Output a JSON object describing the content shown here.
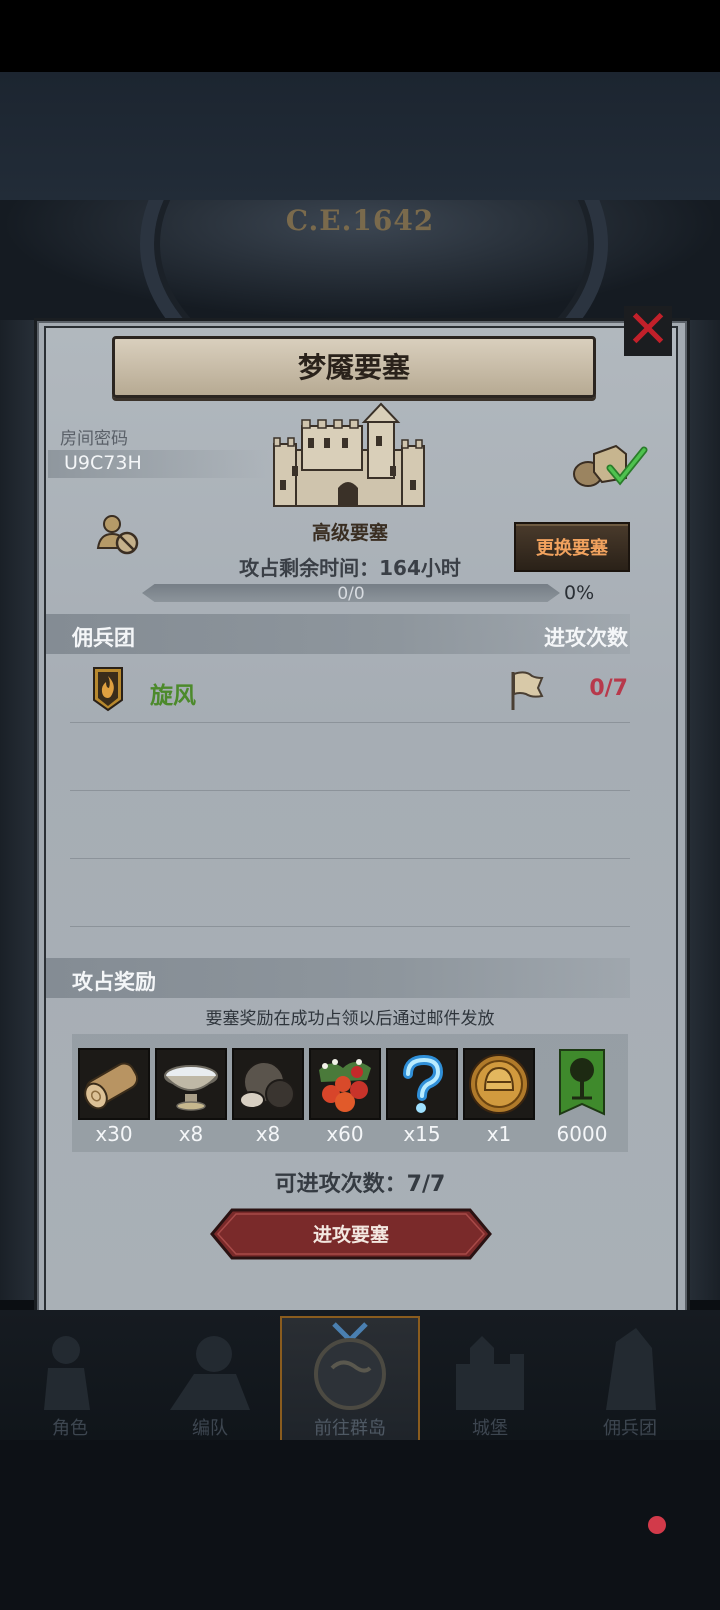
{
  "hud": {
    "year": "C.E.1642"
  },
  "dialog": {
    "title": "梦魇要塞",
    "room_label": "房间密码",
    "room_code": "U9C73H",
    "fortress_level": "高级要塞",
    "change_button": "更换要塞",
    "occupy_time": "攻占剩余时间：164小时",
    "progress": {
      "text": "0/0",
      "percent_label": "0%",
      "fraction": 0
    }
  },
  "mercenary": {
    "header": "佣兵团",
    "attacks_header": "进攻次数",
    "rows": [
      {
        "name": "旋风",
        "attacks": "0/7"
      }
    ]
  },
  "rewards": {
    "header": "攻占奖励",
    "note": "要塞奖励在成功占领以后通过邮件发放",
    "items": [
      {
        "icon": "wood-log-icon",
        "qty": "x30"
      },
      {
        "icon": "stone-bowl-icon",
        "qty": "x8"
      },
      {
        "icon": "truffle-icon",
        "qty": "x8"
      },
      {
        "icon": "berries-icon",
        "qty": "x60"
      },
      {
        "icon": "mystery-question-icon",
        "qty": "x15"
      },
      {
        "icon": "knight-helmet-coin-icon",
        "qty": "x1"
      },
      {
        "icon": "tree-banner-icon",
        "qty": "6000"
      }
    ]
  },
  "attempts": "可进攻次数：7/7",
  "attack_button": "进攻要塞",
  "nav": {
    "items": [
      {
        "label": "角色"
      },
      {
        "label": "编队"
      },
      {
        "label": "前往群岛"
      },
      {
        "label": "城堡"
      },
      {
        "label": "佣兵团"
      }
    ]
  }
}
